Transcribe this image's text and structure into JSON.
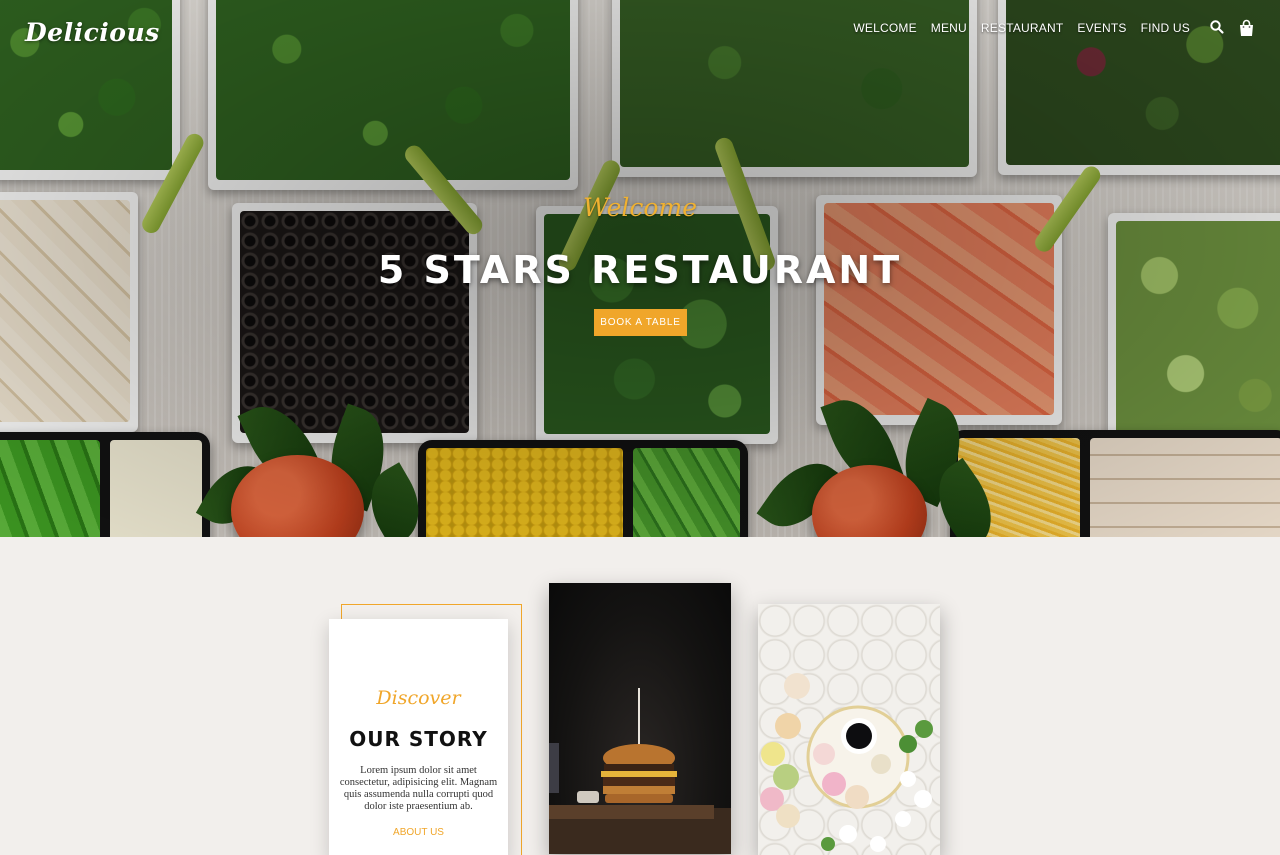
{
  "brand": {
    "logo": "Delicious"
  },
  "nav": {
    "items": [
      "WELCOME",
      "MENU",
      "RESTAURANT",
      "EVENTS",
      "FIND US"
    ]
  },
  "hero": {
    "subtitle": "Welcome",
    "title": "5 STARS RESTAURANT",
    "cta": "BOOK A TABLE"
  },
  "story": {
    "subtitle": "Discover",
    "title": "OUR STORY",
    "body": "Lorem ipsum dolor sit amet consectetur, adipisicing elit. Magnam quis assumenda nulla corrupti quod dolor iste praesentium ab.",
    "link": "ABOUT US"
  },
  "colors": {
    "accent": "#f0a62a",
    "background": "#f2efec",
    "text": "#111111"
  },
  "icons": {
    "search": "search-icon",
    "cart": "shopping-bag-icon"
  }
}
